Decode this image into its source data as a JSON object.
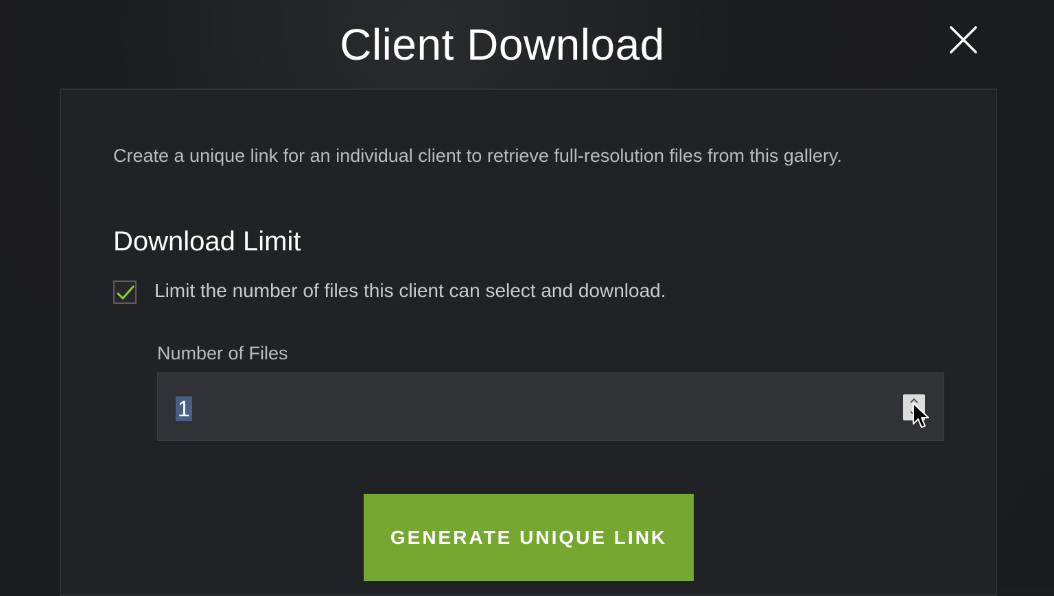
{
  "modal": {
    "title": "Client Download",
    "close_icon": "close-icon"
  },
  "description": "Create a unique link for an individual client to retrieve full-resolution files from this gallery.",
  "download_limit": {
    "heading": "Download Limit",
    "checkbox_checked": true,
    "checkbox_label": "Limit the number of files this client can select and download.",
    "field_label": "Number of Files",
    "field_value": "1"
  },
  "actions": {
    "generate_label": "GENERATE UNIQUE LINK"
  },
  "colors": {
    "accent_green": "#76a730",
    "check_green": "#8bd12e",
    "selection_blue": "#4b5f86"
  }
}
